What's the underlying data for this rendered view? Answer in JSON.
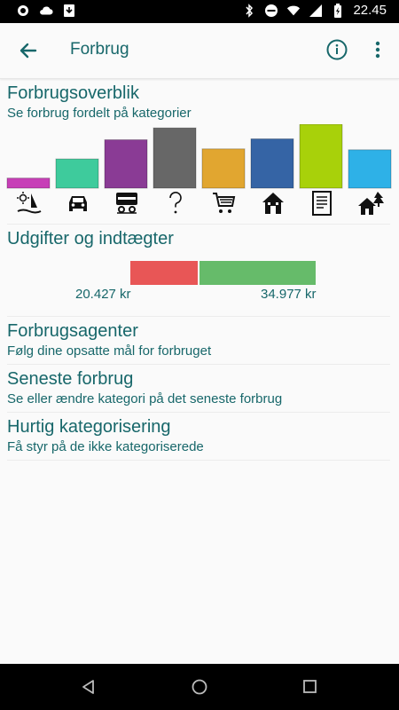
{
  "status_bar": {
    "time": "22.45"
  },
  "app_bar": {
    "title": "Forbrug"
  },
  "overview": {
    "title": "Forbrugsoverblik",
    "subtitle": "Se forbrug fordelt på kategorier"
  },
  "chart_data": {
    "type": "bar",
    "categories": [
      "sun-sail",
      "car",
      "transit",
      "unknown",
      "shopping-cart",
      "house",
      "document",
      "house-trees"
    ],
    "values": [
      11,
      32,
      53,
      66,
      43,
      54,
      70,
      42
    ],
    "colors": [
      "#c73fb7",
      "#3ecb9c",
      "#8a3b95",
      "#676767",
      "#e1a630",
      "#3564a5",
      "#a8d10a",
      "#2eb1e7"
    ],
    "ylim": [
      0,
      70
    ],
    "grid": false
  },
  "income_expense": {
    "title": "Udgifter og indtægter",
    "expense_label": "20.427 kr",
    "income_label": "34.977 kr",
    "expense_value": 20427,
    "income_value": 34977,
    "expense_color": "#e85656",
    "income_color": "#66bb6a"
  },
  "agents": {
    "title": "Forbrugsagenter",
    "subtitle": "Følg dine opsatte mål for forbruget"
  },
  "latest": {
    "title": "Seneste forbrug",
    "subtitle": "Se eller ændre kategori på det seneste forbrug"
  },
  "quick": {
    "title": "Hurtig kategorisering",
    "subtitle": "Få styr på de ikke kategoriserede"
  },
  "theme": {
    "accent": "#17676a"
  }
}
